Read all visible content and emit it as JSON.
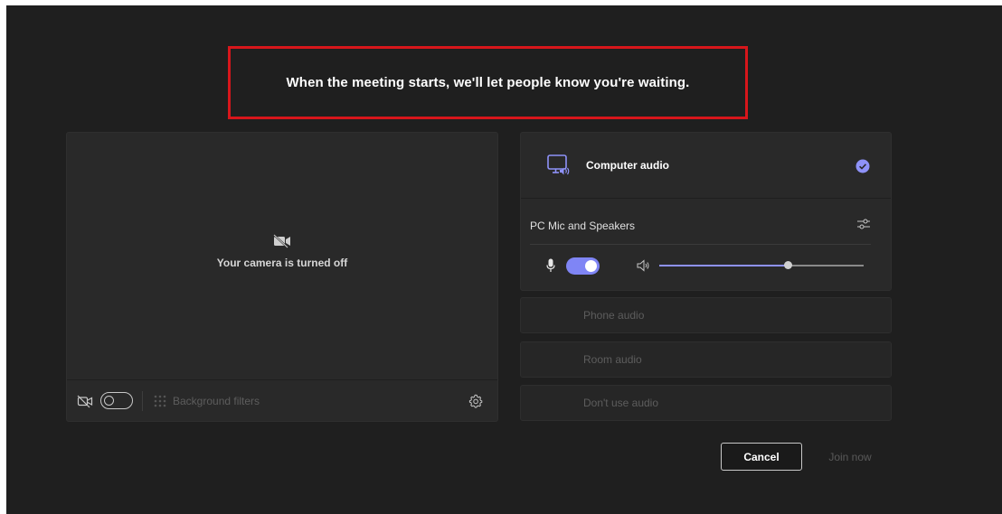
{
  "banner": {
    "text": "When the meeting starts, we'll let people know you're waiting."
  },
  "camera": {
    "status_text": "Your camera is turned off",
    "background_filters_label": "Background filters",
    "camera_on": false
  },
  "audio": {
    "selected_option": "Computer audio",
    "device_label": "PC Mic and Speakers",
    "mic_on": true,
    "volume": 0.63,
    "options": [
      {
        "label": "Phone audio"
      },
      {
        "label": "Room audio"
      },
      {
        "label": "Don't use audio"
      }
    ]
  },
  "buttons": {
    "cancel": "Cancel",
    "join": "Join now"
  },
  "colors": {
    "accent": "#7f85f5",
    "highlight_border": "#d7161b",
    "background": "#1f1f1f",
    "panel": "#292929"
  },
  "icons": [
    "camera-off-icon",
    "background-filters-icon",
    "settings-gear-icon",
    "computer-audio-icon",
    "check-circle-icon",
    "device-settings-icon",
    "microphone-icon",
    "speaker-icon"
  ]
}
